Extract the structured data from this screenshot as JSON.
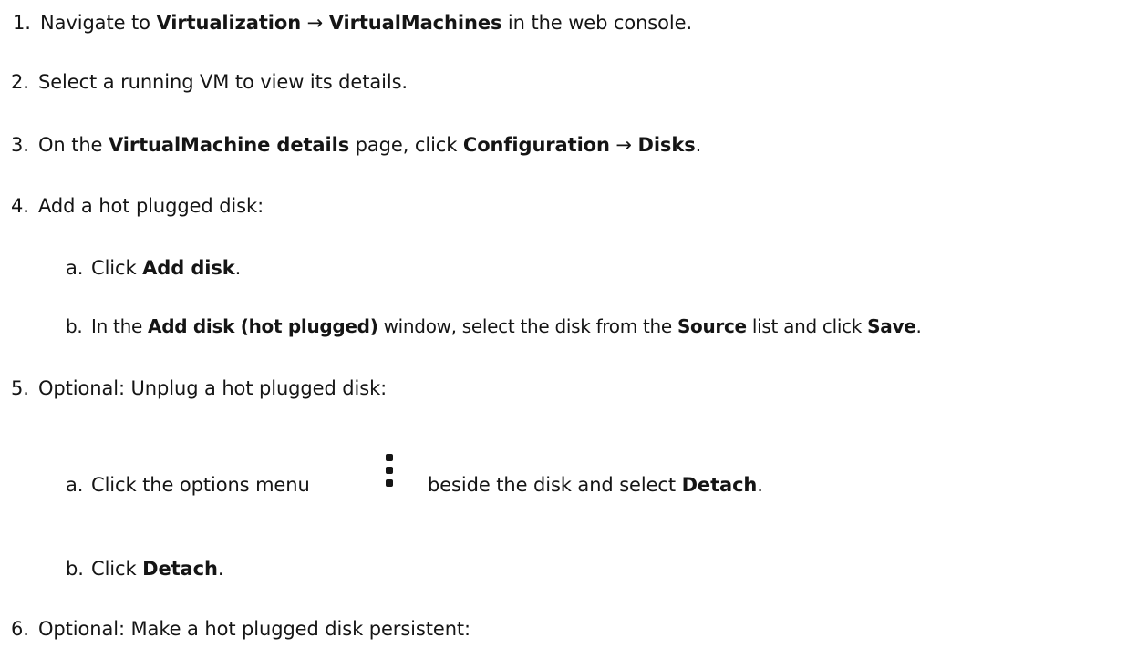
{
  "steps": [
    {
      "num": "1.",
      "parts": [
        {
          "t": "Navigate to ",
          "b": false
        },
        {
          "t": "Virtualization",
          "b": true
        },
        {
          "t": " → ",
          "b": false
        },
        {
          "t": "VirtualMachines",
          "b": true
        },
        {
          "t": " in the web console.",
          "b": false
        }
      ]
    },
    {
      "num": "2.",
      "parts": [
        {
          "t": "Select a running VM to view its details.",
          "b": false
        }
      ]
    },
    {
      "num": "3.",
      "parts": [
        {
          "t": "On the ",
          "b": false
        },
        {
          "t": "VirtualMachine details",
          "b": true
        },
        {
          "t": " page, click ",
          "b": false
        },
        {
          "t": "Configuration",
          "b": true
        },
        {
          "t": " → ",
          "b": false
        },
        {
          "t": "Disks",
          "b": true
        },
        {
          "t": ".",
          "b": false
        }
      ]
    },
    {
      "num": "4.",
      "parts": [
        {
          "t": "Add a hot plugged disk:",
          "b": false
        }
      ]
    },
    {
      "num": "a.",
      "parts": [
        {
          "t": "Click ",
          "b": false
        },
        {
          "t": "Add disk",
          "b": true
        },
        {
          "t": ".",
          "b": false
        }
      ]
    },
    {
      "num": "b.",
      "parts": [
        {
          "t": "In the ",
          "b": false
        },
        {
          "t": "Add disk (hot plugged)",
          "b": true
        },
        {
          "t": " window, select the disk from the ",
          "b": false
        },
        {
          "t": "Source",
          "b": true
        },
        {
          "t": " list and click ",
          "b": false
        },
        {
          "t": "Save",
          "b": true
        },
        {
          "t": ".",
          "b": false
        }
      ]
    },
    {
      "num": "5.",
      "parts": [
        {
          "t": "Optional: Unplug a hot plugged disk:",
          "b": false
        }
      ]
    },
    {
      "num": "a.",
      "parts": [
        {
          "t": "Click the options menu ",
          "b": false
        },
        {
          "t": "beside the disk and select ",
          "b": false
        },
        {
          "t": "Detach",
          "b": true
        },
        {
          "t": ".",
          "b": false
        }
      ]
    },
    {
      "num": "b.",
      "parts": [
        {
          "t": "Click ",
          "b": false
        },
        {
          "t": "Detach",
          "b": true
        },
        {
          "t": ".",
          "b": false
        }
      ]
    },
    {
      "num": "6.",
      "parts": [
        {
          "t": "Optional: Make a hot plugged disk persistent:",
          "b": false
        }
      ]
    }
  ],
  "icons": {
    "options_menu": "kebab-icon"
  }
}
